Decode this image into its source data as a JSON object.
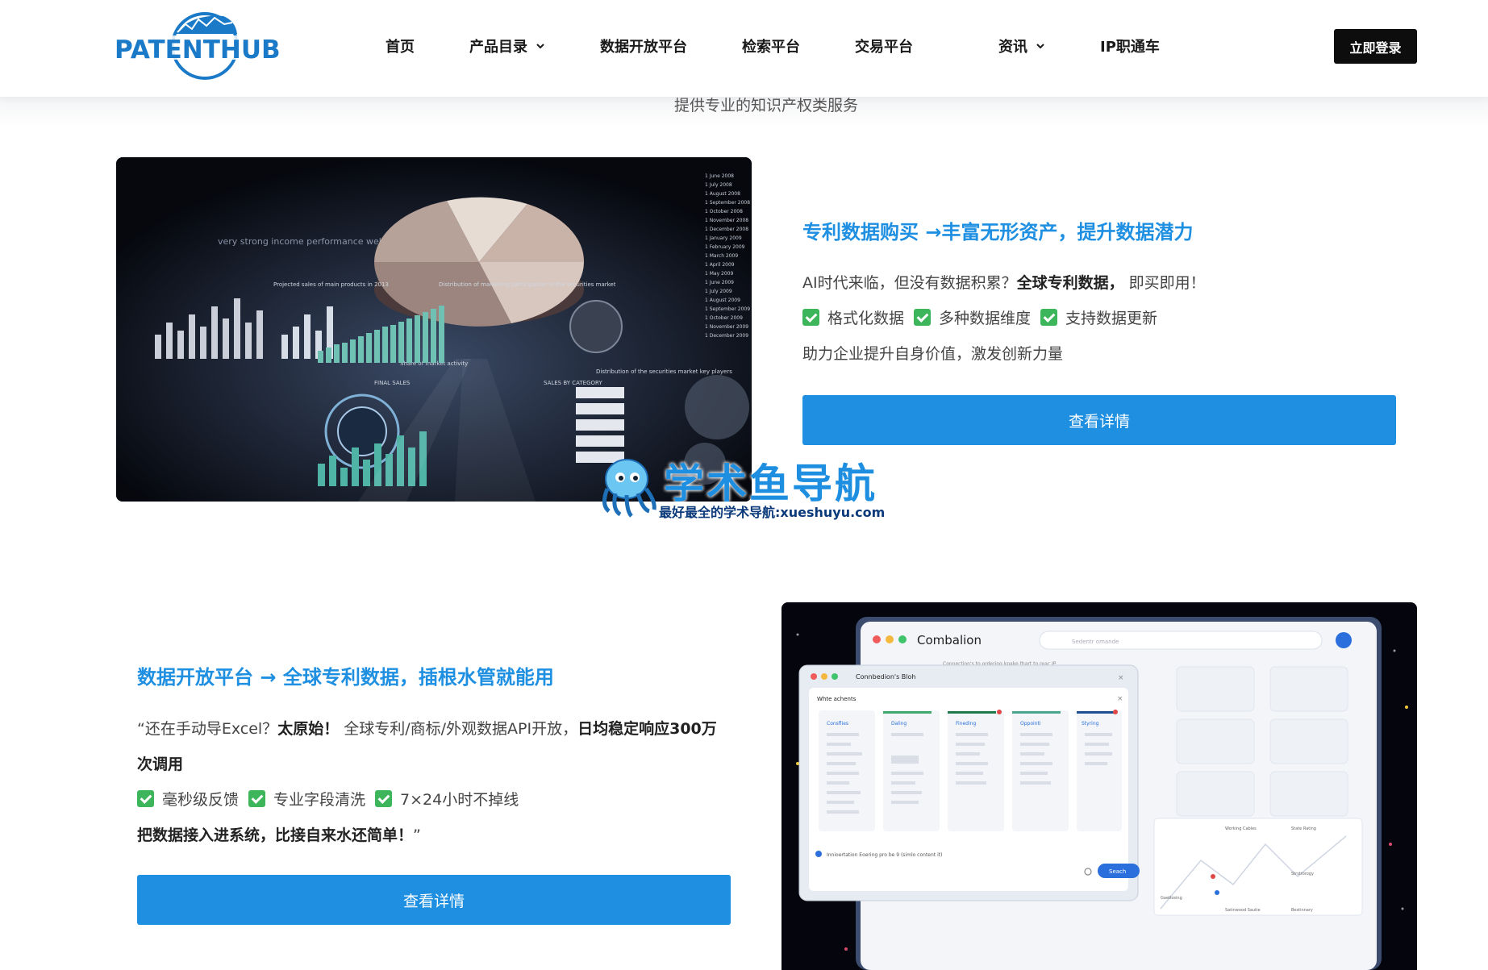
{
  "header": {
    "logo_text": "PATENTHUB",
    "nav": [
      {
        "label": "首页",
        "dropdown": false
      },
      {
        "label": "产品目录",
        "dropdown": true
      },
      {
        "label": "数据开放平台",
        "dropdown": false
      },
      {
        "label": "检索平台",
        "dropdown": false
      },
      {
        "label": "交易平台",
        "dropdown": false
      },
      {
        "label": "资讯",
        "dropdown": true
      },
      {
        "label": "IP职通车",
        "dropdown": false
      }
    ],
    "login_label": "立即登录"
  },
  "subtitle": "提供专业的知识产权类服务",
  "feature1": {
    "title": "专利数据购买 →丰富无形资产，提升数据潜力",
    "line1_a": "AI时代来临，但没有数据积累？",
    "line1_b": "全球专利数据，",
    "line1_c": " 即买即用！",
    "checks": [
      "格式化数据",
      "多种数据维度",
      "支持数据更新"
    ],
    "line3": "助力企业提升自身价值，激发创新力量",
    "button": "查看详情",
    "image": {
      "caption": "very strong income performance well ahead of forecast",
      "labels": [
        "Projected sales of main products in 2013",
        "Distribution of marketing participation in the securities market",
        "Share of market activity",
        "Distribution of the securities market key players",
        "FINAL SALES",
        "SALES BY CATEGORY"
      ],
      "dates": [
        "1 June 2008",
        "1 July 2008",
        "1 August 2008",
        "1 September 2008",
        "1 October 2008",
        "1 November 2008",
        "1 December 2008",
        "1 January 2009",
        "1 February 2009",
        "1 March 2009",
        "1 April 2009",
        "1 May 2009",
        "1 June 2009",
        "1 July 2009",
        "1 August 2009",
        "1 September 2009",
        "1 October 2009",
        "1 November 2009",
        "1 December 2009"
      ]
    }
  },
  "feature2": {
    "title": "数据开放平台 → 全球专利数据，插根水管就能用",
    "line1_a": "“还在手动导Excel？",
    "line1_b": "太原始！",
    "line1_c": " 全球专利/商标/外观数据API开放，",
    "line1_d": "日均稳定响应300万",
    "line1_e": "次调用",
    "checks": [
      "毫秒级反馈",
      "专业字段清洗",
      "7×24小时不掉线"
    ],
    "line3_a": "把数据接入进系统，比接自来水还简单！",
    "line3_b": "”",
    "button": "查看详情",
    "mockup": {
      "window_title": "Combalion",
      "search_placeholder": "Sedentr omande",
      "subtitle_line": "Connection's to ordering kpake thart to reac JP",
      "dialog_title": "Connbedion's Bloh",
      "panel_title": "Whte achents",
      "columns": [
        "Consflies",
        "Daling",
        "Fineding",
        "Oppointi",
        "Styring"
      ],
      "footer_text": "Innioertation Eoering pro be 9 (simlo content it)",
      "search_button": "Seach",
      "map_labels": [
        "Working Cables",
        "State Rating",
        "Strstrorogy",
        "Gaetlosing",
        "Satinwood Sautie",
        "Bestinnary"
      ]
    }
  },
  "watermark": {
    "title": "学术鱼导航",
    "subtitle": "最好最全的学术导航:xueshuyu.com"
  }
}
